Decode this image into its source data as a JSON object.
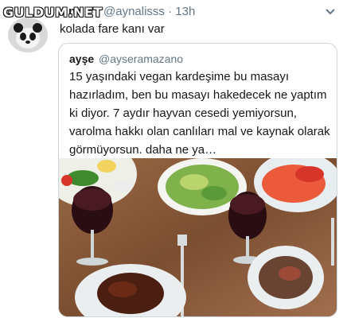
{
  "watermark": "GULDUM.NET",
  "tweet": {
    "author_name": "n",
    "handle": "@aynalisss",
    "separator": "·",
    "time": "13h",
    "text": "kolada fare kanı var"
  },
  "quoted": {
    "author_name": "ayşe",
    "handle": "@ayseramazano",
    "text": "15 yaşındaki vegan kardeşime bu masayı hazırladım, ben bu masayı hakedecek ne yaptım ki diyor. 7 aydır hayvan cesedi yemiyorsun, varolma hakkı olan canlıları mal ve kaynak olarak görmüyorsun. daha ne ya…"
  },
  "colors": {
    "text": "#14171a",
    "secondary": "#657786",
    "border": "#ccd6dd",
    "table": "#8a5a3a"
  },
  "icons": [
    "chevron-down-icon",
    "panda-avatar"
  ]
}
